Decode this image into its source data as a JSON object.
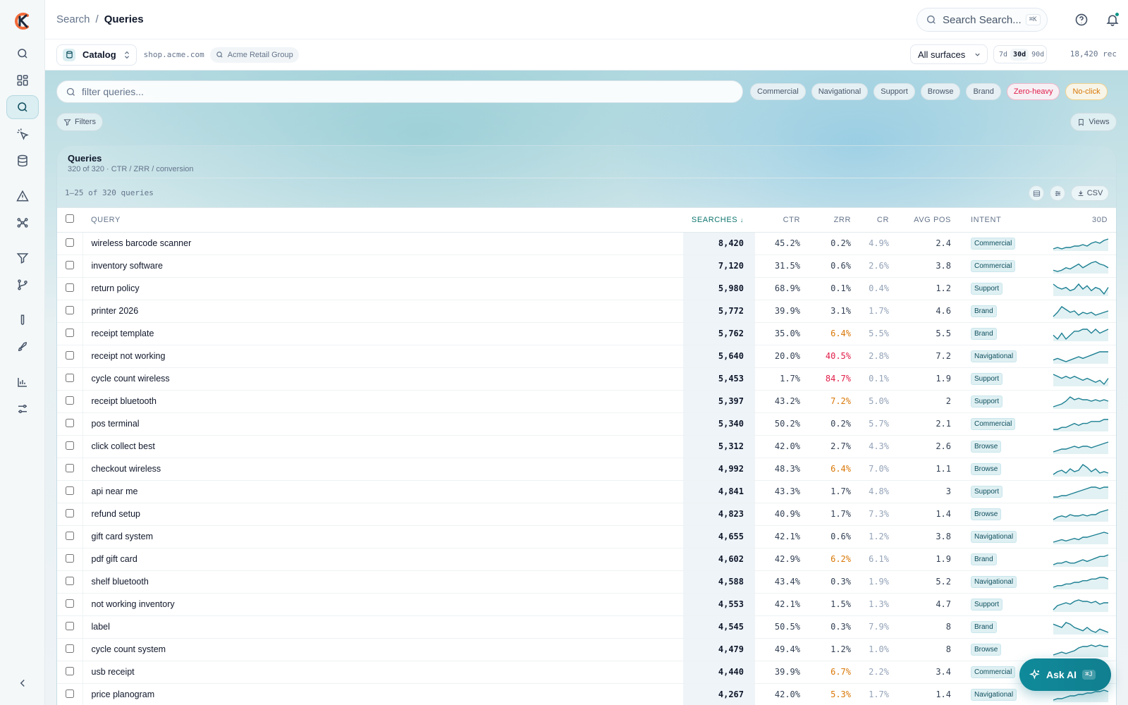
{
  "breadcrumb": {
    "root": "Search",
    "separator": "/",
    "current": "Queries"
  },
  "top_search": {
    "placeholder": "Search Search...",
    "shortcut": "⌘K"
  },
  "context": {
    "catalog_label": "Catalog",
    "domain": "shop.acme.com",
    "org": "Acme Retail Group",
    "surface": "All surfaces",
    "ranges": [
      "7d",
      "30d",
      "90d"
    ],
    "active_range": "30d",
    "record_count": "18,420 rec"
  },
  "filter": {
    "placeholder": "filter queries..."
  },
  "chips": [
    "Commercial",
    "Navigational",
    "Support",
    "Browse",
    "Brand",
    "Zero-heavy",
    "No-click"
  ],
  "buttons": {
    "filters": "Filters",
    "views": "Views",
    "csv": "CSV"
  },
  "card": {
    "title": "Queries",
    "subtitle": "320 of 320 · CTR / ZRR / conversion",
    "range_text": "1–25 of 320 queries"
  },
  "columns": {
    "query": "QUERY",
    "searches": "SEARCHES",
    "ctr": "CTR",
    "zrr": "ZRR",
    "cr": "CR",
    "avg_pos": "AVG POS",
    "intent": "INTENT",
    "trend": "30D"
  },
  "rows": [
    {
      "query": "wireless barcode scanner",
      "searches": "8,420",
      "ctr": "45.2%",
      "zrr": "0.2%",
      "cr": "4.9%",
      "pos": "2.4",
      "intent": "Commercial",
      "spark": [
        10,
        11,
        10,
        11,
        11,
        12,
        12,
        13,
        12,
        14,
        15,
        14,
        16,
        17
      ]
    },
    {
      "query": "inventory software",
      "searches": "7,120",
      "ctr": "31.5%",
      "zrr": "0.6%",
      "cr": "2.6%",
      "pos": "3.8",
      "intent": "Commercial",
      "spark": [
        9,
        8,
        9,
        11,
        10,
        12,
        14,
        11,
        13,
        15,
        16,
        14,
        13,
        11
      ]
    },
    {
      "query": "return policy",
      "searches": "5,980",
      "ctr": "68.9%",
      "zrr": "0.1%",
      "cr": "0.4%",
      "pos": "1.2",
      "intent": "Support",
      "spark": [
        15,
        13,
        12,
        13,
        11,
        12,
        15,
        12,
        14,
        11,
        13,
        12,
        9,
        13
      ]
    },
    {
      "query": "printer 2026",
      "searches": "5,772",
      "ctr": "39.9%",
      "zrr": "3.1%",
      "cr": "1.7%",
      "pos": "4.6",
      "intent": "Brand",
      "spark": [
        8,
        11,
        15,
        13,
        11,
        12,
        9,
        11,
        10,
        11,
        9,
        10,
        11,
        12
      ]
    },
    {
      "query": "receipt template",
      "searches": "5,762",
      "ctr": "35.0%",
      "zrr": "6.4%",
      "cr": "5.5%",
      "pos": "5.5",
      "intent": "Brand",
      "spark": [
        11,
        9,
        12,
        9,
        11,
        13,
        13,
        14,
        14,
        12,
        14,
        12,
        13,
        14
      ]
    },
    {
      "query": "receipt not working",
      "searches": "5,640",
      "ctr": "20.0%",
      "zrr": "40.5%",
      "cr": "2.8%",
      "pos": "7.2",
      "intent": "Navigational",
      "spark": [
        10,
        11,
        10,
        9,
        10,
        11,
        12,
        11,
        12,
        13,
        14,
        15,
        15,
        15
      ]
    },
    {
      "query": "cycle count wireless",
      "searches": "5,453",
      "ctr": "1.7%",
      "zrr": "84.7%",
      "cr": "0.1%",
      "pos": "1.9",
      "intent": "Support",
      "spark": [
        14,
        13,
        12,
        13,
        12,
        13,
        12,
        11,
        12,
        11,
        10,
        11,
        9,
        12
      ]
    },
    {
      "query": "receipt bluetooth",
      "searches": "5,397",
      "ctr": "43.2%",
      "zrr": "7.2%",
      "cr": "5.0%",
      "pos": "2",
      "intent": "Support",
      "spark": [
        8,
        9,
        10,
        12,
        15,
        13,
        14,
        13,
        13,
        12,
        13,
        12,
        13,
        12
      ]
    },
    {
      "query": "pos terminal",
      "searches": "5,340",
      "ctr": "50.2%",
      "zrr": "0.2%",
      "cr": "5.7%",
      "pos": "2.1",
      "intent": "Commercial",
      "spark": [
        9,
        9,
        10,
        10,
        11,
        12,
        11,
        12,
        12,
        13,
        13,
        13,
        14,
        14
      ]
    },
    {
      "query": "click collect best",
      "searches": "5,312",
      "ctr": "42.0%",
      "zrr": "2.7%",
      "cr": "4.3%",
      "pos": "2.6",
      "intent": "Browse",
      "spark": [
        8,
        9,
        10,
        10,
        11,
        12,
        11,
        12,
        12,
        11,
        12,
        13,
        14,
        15
      ]
    },
    {
      "query": "checkout wireless",
      "searches": "4,992",
      "ctr": "48.3%",
      "zrr": "6.4%",
      "cr": "7.0%",
      "pos": "1.1",
      "intent": "Browse",
      "spark": [
        9,
        11,
        12,
        10,
        13,
        11,
        12,
        16,
        14,
        11,
        13,
        10,
        11,
        10
      ]
    },
    {
      "query": "api near me",
      "searches": "4,841",
      "ctr": "43.3%",
      "zrr": "1.7%",
      "cr": "4.8%",
      "pos": "3",
      "intent": "Support",
      "spark": [
        8,
        8,
        9,
        9,
        10,
        11,
        12,
        13,
        14,
        15,
        15,
        14,
        15,
        15
      ]
    },
    {
      "query": "refund setup",
      "searches": "4,823",
      "ctr": "40.9%",
      "zrr": "1.7%",
      "cr": "7.3%",
      "pos": "1.4",
      "intent": "Browse",
      "spark": [
        8,
        10,
        11,
        10,
        12,
        11,
        11,
        12,
        11,
        12,
        12,
        14,
        15,
        16
      ]
    },
    {
      "query": "gift card system",
      "searches": "4,655",
      "ctr": "42.1%",
      "zrr": "0.6%",
      "cr": "1.2%",
      "pos": "3.8",
      "intent": "Navigational",
      "spark": [
        8,
        9,
        10,
        9,
        10,
        11,
        10,
        12,
        12,
        13,
        14,
        15,
        16,
        15
      ]
    },
    {
      "query": "pdf gift card",
      "searches": "4,602",
      "ctr": "42.9%",
      "zrr": "6.2%",
      "cr": "6.1%",
      "pos": "1.9",
      "intent": "Brand",
      "spark": [
        9,
        10,
        10,
        11,
        10,
        10,
        11,
        12,
        11,
        12,
        13,
        14,
        14,
        15
      ]
    },
    {
      "query": "shelf bluetooth",
      "searches": "4,588",
      "ctr": "43.4%",
      "zrr": "0.3%",
      "cr": "1.9%",
      "pos": "5.2",
      "intent": "Navigational",
      "spark": [
        9,
        10,
        10,
        11,
        11,
        12,
        12,
        13,
        13,
        14,
        14,
        15,
        15,
        14
      ]
    },
    {
      "query": "not working inventory",
      "searches": "4,553",
      "ctr": "42.1%",
      "zrr": "1.5%",
      "cr": "1.3%",
      "pos": "4.7",
      "intent": "Support",
      "spark": [
        8,
        11,
        12,
        13,
        12,
        14,
        15,
        14,
        14,
        13,
        14,
        12,
        13,
        13
      ]
    },
    {
      "query": "label",
      "searches": "4,545",
      "ctr": "50.5%",
      "zrr": "0.3%",
      "cr": "7.9%",
      "pos": "8",
      "intent": "Brand",
      "spark": [
        14,
        13,
        12,
        15,
        14,
        12,
        11,
        10,
        12,
        10,
        9,
        11,
        10,
        9
      ]
    },
    {
      "query": "cycle count system",
      "searches": "4,479",
      "ctr": "49.4%",
      "zrr": "1.2%",
      "cr": "1.0%",
      "pos": "8",
      "intent": "Browse",
      "spark": [
        8,
        9,
        10,
        9,
        10,
        11,
        13,
        14,
        14,
        15,
        14,
        15,
        14,
        14
      ]
    },
    {
      "query": "usb receipt",
      "searches": "4,440",
      "ctr": "39.9%",
      "zrr": "6.7%",
      "cr": "2.2%",
      "pos": "3.4",
      "intent": "Commercial",
      "spark": [
        9,
        10,
        10,
        11,
        11,
        12,
        12,
        12,
        13,
        13,
        13,
        14,
        14,
        14
      ]
    },
    {
      "query": "price planogram",
      "searches": "4,267",
      "ctr": "42.0%",
      "zrr": "5.3%",
      "cr": "1.7%",
      "pos": "1.4",
      "intent": "Navigational",
      "spark": [
        8,
        9,
        9,
        10,
        11,
        11,
        12,
        12,
        13,
        13,
        14,
        14,
        15,
        14
      ]
    }
  ],
  "ask_ai": {
    "label": "Ask AI",
    "shortcut": "⌘J"
  },
  "colors": {
    "accent": "#0f8a9a",
    "zero_heavy": "#e11d48",
    "no_click": "#d97706"
  }
}
